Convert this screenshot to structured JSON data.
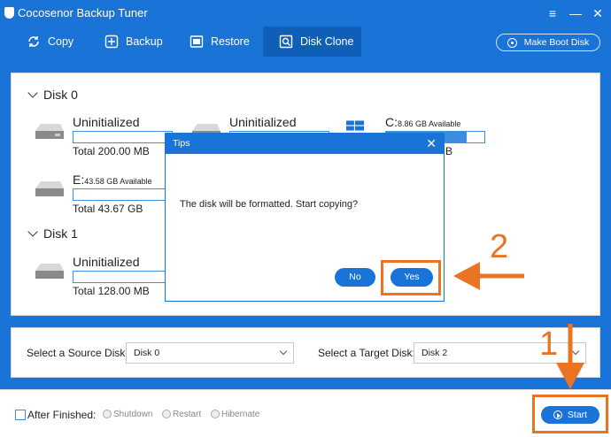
{
  "app": {
    "title": "Cocosenor Backup Tuner"
  },
  "window_controls": {
    "menu": "≡",
    "minimize": "—",
    "close": "✕"
  },
  "toolbar": {
    "items": [
      {
        "label": "Copy",
        "icon": "copy-icon"
      },
      {
        "label": "Backup",
        "icon": "backup-icon"
      },
      {
        "label": "Restore",
        "icon": "restore-icon"
      },
      {
        "label": "Disk Clone",
        "icon": "disk-clone-icon",
        "active": true
      }
    ],
    "boot_label": "Make Boot Disk"
  },
  "disks": [
    {
      "title": "Disk 0",
      "partitions": [
        {
          "name": "Uninitialized",
          "avail": "",
          "fill": 0,
          "total": "Total 200.00 MB",
          "icon": "drive-icon"
        },
        {
          "name": "Uninitialized",
          "avail": "",
          "fill": 0,
          "total": "",
          "icon": "drive-icon"
        },
        {
          "name": "C:",
          "avail": "8.86 GB Available",
          "fill": 0.82,
          "total": "B",
          "icon": "windows-icon"
        },
        {
          "name": "E:",
          "avail": "43.58 GB Available",
          "fill": 0,
          "total": "Total 43.67 GB",
          "icon": "drive-icon"
        }
      ]
    },
    {
      "title": "Disk 1",
      "partitions": [
        {
          "name": "Uninitialized",
          "avail": "",
          "fill": 0,
          "total": "Total 128.00 MB",
          "icon": "drive-icon"
        }
      ]
    }
  ],
  "selectors": {
    "source_label": "Select a Source Disk:",
    "source_value": "Disk 0",
    "target_label": "Select a Target Disk:",
    "target_value": "Disk 2"
  },
  "footer": {
    "after_label": "After Finished:",
    "options": [
      "Shutdown",
      "Restart",
      "Hibernate"
    ],
    "start_label": "Start"
  },
  "dialog": {
    "title": "Tips",
    "message": "The disk will be formatted. Start copying?",
    "no_label": "No",
    "yes_label": "Yes"
  },
  "annotations": {
    "step1": "1",
    "step2": "2",
    "color": "#ea7424"
  },
  "colors": {
    "primary": "#1a73d6",
    "active_tab": "#0f5fb8",
    "bar": "#3c8fe0"
  }
}
